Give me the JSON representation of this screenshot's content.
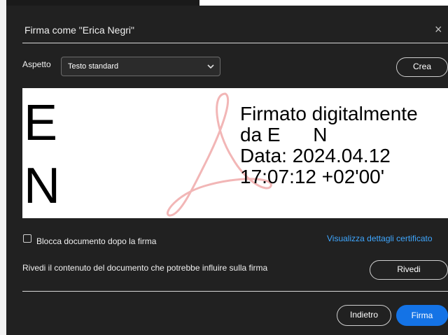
{
  "dialog": {
    "title": "Firma come \"Erica Negri\"",
    "close_glyph": "×"
  },
  "appearance": {
    "label": "Aspetto",
    "selected": "Testo standard",
    "create_button": "Crea"
  },
  "preview": {
    "initials": [
      "E",
      "N"
    ],
    "lines": [
      "Firmato digitalmente",
      "da E      N",
      "Data: 2024.04.12",
      "17:07:12 +02'00'"
    ],
    "watermark_icon": "acrobat-logo-icon"
  },
  "options": {
    "lock_label": "Blocca documento dopo la firma",
    "lock_checked": false,
    "certificate_link": "Visualizza dettagli certificato"
  },
  "review": {
    "text": "Rivedi il contenuto del documento che potrebbe influire sulla firma",
    "button": "Rivedi"
  },
  "footer": {
    "back_button": "Indietro",
    "sign_button": "Firma"
  },
  "colors": {
    "dialog_bg": "#212121",
    "accent": "#1473e6",
    "link": "#3fa7ff"
  }
}
